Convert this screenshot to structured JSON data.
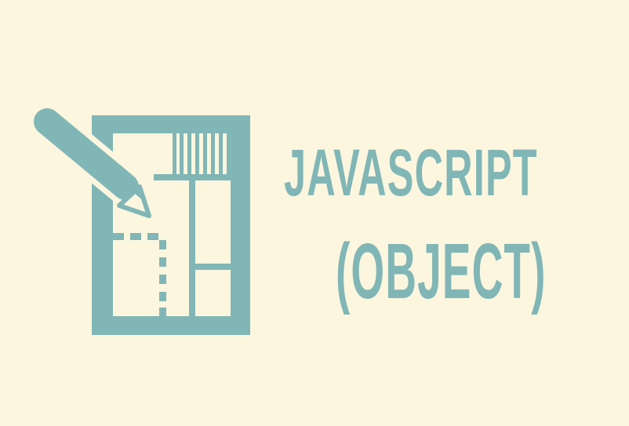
{
  "title": {
    "line1": "JAVASCRIPT",
    "line2": "(OBJECT)"
  },
  "icon": {
    "name": "floor-plan-pencil-icon"
  },
  "colors": {
    "background": "#fcf6df",
    "accent": "#81b6b6"
  }
}
